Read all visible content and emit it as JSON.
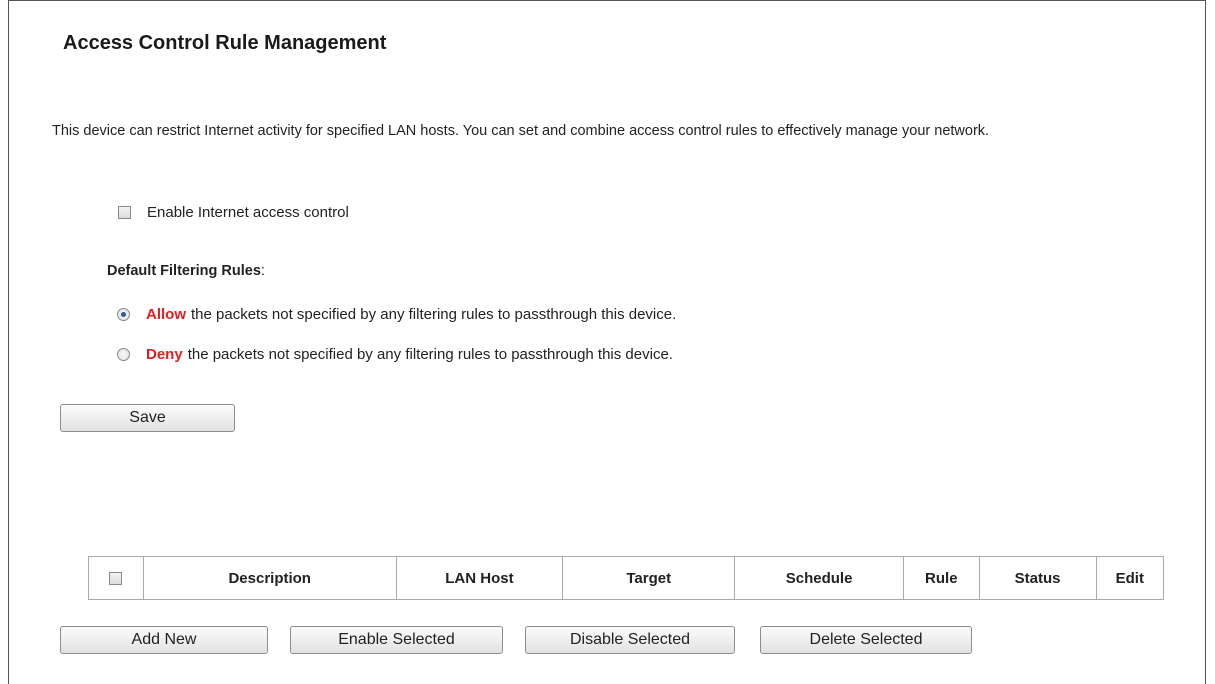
{
  "page": {
    "title": "Access Control Rule Management",
    "intro": "This device can restrict Internet activity for specified LAN hosts. You can set and combine access control rules to effectively manage your network."
  },
  "access_control": {
    "enable_label": "Enable Internet access control",
    "enabled": false
  },
  "default_rules": {
    "heading": "Default Filtering Rules",
    "heading_suffix": ":",
    "selected": "allow",
    "options": [
      {
        "keyword": "Allow",
        "text": "the packets not specified by any filtering rules to passthrough this device."
      },
      {
        "keyword": "Deny",
        "text": "the packets not specified by any filtering rules to passthrough this device."
      }
    ]
  },
  "buttons": {
    "save": "Save",
    "add_new": "Add New",
    "enable_selected": "Enable Selected",
    "disable_selected": "Disable Selected",
    "delete_selected": "Delete Selected"
  },
  "table": {
    "columns": [
      "Description",
      "LAN Host",
      "Target",
      "Schedule",
      "Rule",
      "Status",
      "Edit"
    ],
    "rows": []
  },
  "colors": {
    "keyword": "#e02020",
    "radio_dot": "#2c5aa0"
  }
}
